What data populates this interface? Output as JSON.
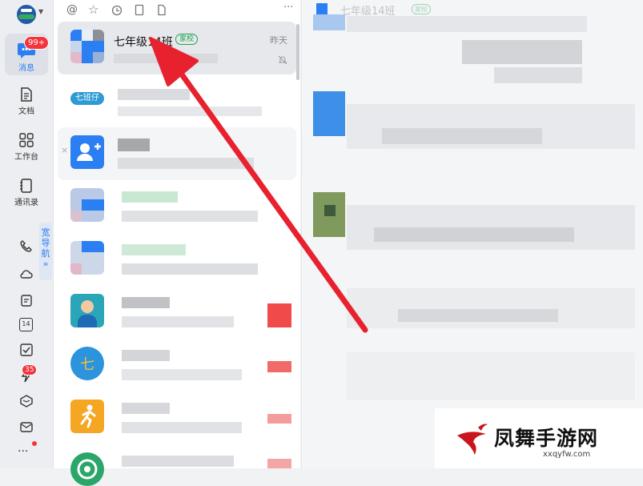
{
  "nav": {
    "messages_label": "消息",
    "messages_badge": "99+",
    "docs_label": "文档",
    "workbench_label": "工作台",
    "contacts_label": "通讯录",
    "guide_label": "宽导航",
    "guide_arrow": "»",
    "calendar_day": "14",
    "notify_badge": "35",
    "more_label": "···"
  },
  "toolbar": {
    "more": "···"
  },
  "list": {
    "first": {
      "name": "七年级14班",
      "tag": "家校",
      "time": "昨天",
      "close_mark": "×"
    },
    "avatar2_text": "七班仔",
    "avatar7_text": "七"
  },
  "chat": {
    "header_title": "七年级14班",
    "header_tag": "家校"
  },
  "watermark": {
    "brand": "凤舞手游网",
    "domain": "xxqyfw.com"
  },
  "colors": {
    "accent_blue": "#2c7ff2",
    "badge_red": "#f4333c",
    "arrow_red": "#e8212f",
    "tag_green": "#22a34f"
  }
}
